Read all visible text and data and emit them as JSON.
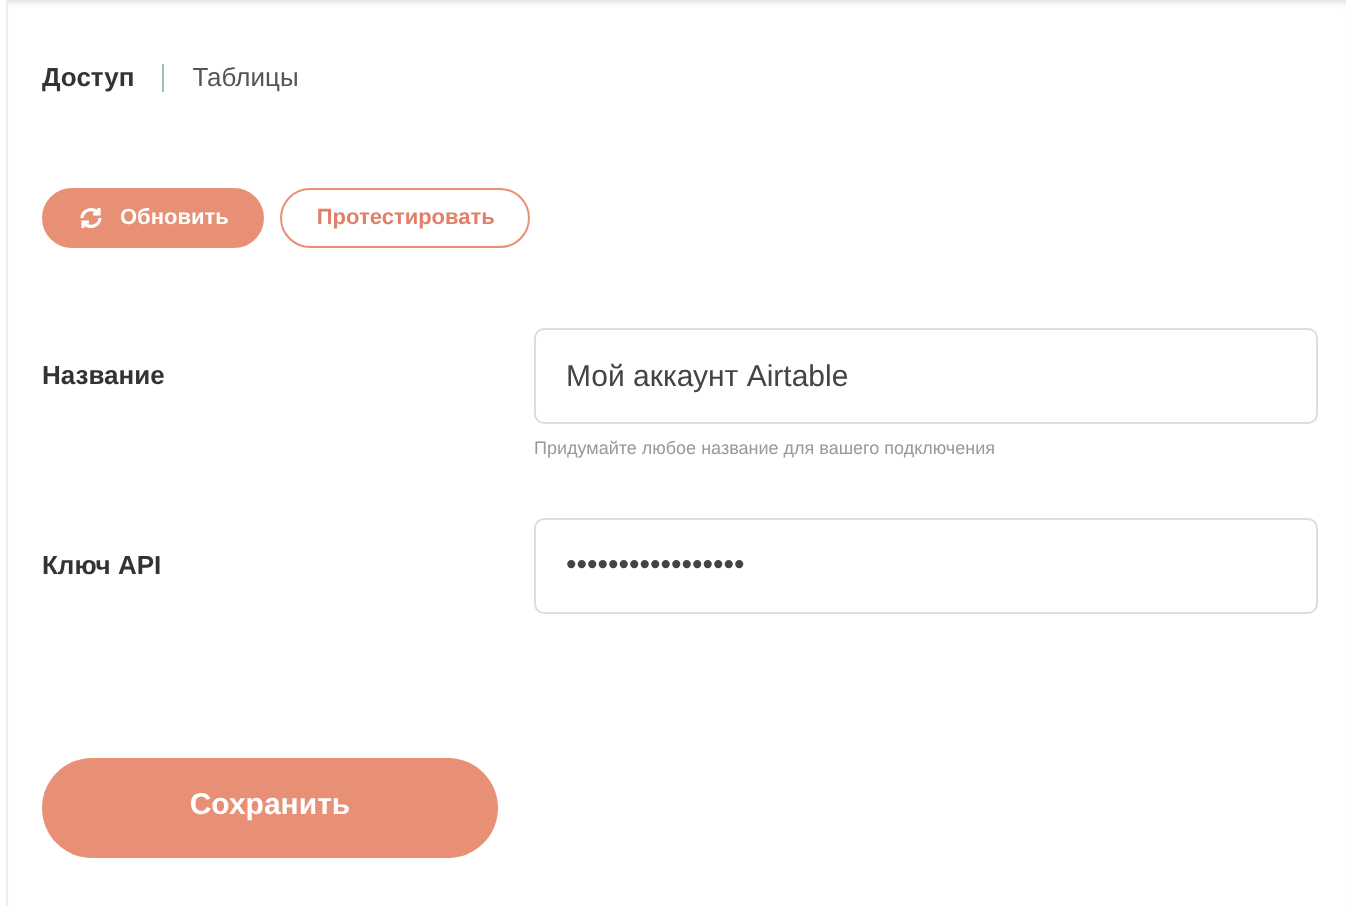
{
  "tabs": [
    {
      "label": "Доступ",
      "selected": true
    },
    {
      "label": "Таблицы",
      "selected": false
    }
  ],
  "actions": [
    {
      "label": "Обновить",
      "kind": "primary"
    },
    {
      "label": "Протестировать",
      "kind": "outline"
    }
  ],
  "fields": [
    {
      "label": "Название",
      "value": "Мой аккаунт Airtable",
      "hint": "Придумайте любое название для вашего подключения"
    },
    {
      "label": "Ключ API",
      "value": "•••••••••••••••••"
    }
  ],
  "save_button": "Сохранить"
}
